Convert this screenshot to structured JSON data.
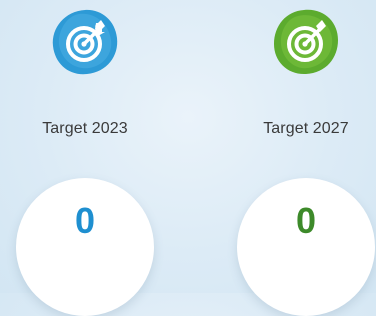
{
  "targets": [
    {
      "icon": "target-icon",
      "label": "Target 2023",
      "value": "0",
      "color": "#1e8fd0",
      "blob_color": "#2d9ad6"
    },
    {
      "icon": "target-icon",
      "label": "Target 2027",
      "value": "0",
      "color": "#3d8a2a",
      "blob_color": "#5cab2e"
    }
  ]
}
